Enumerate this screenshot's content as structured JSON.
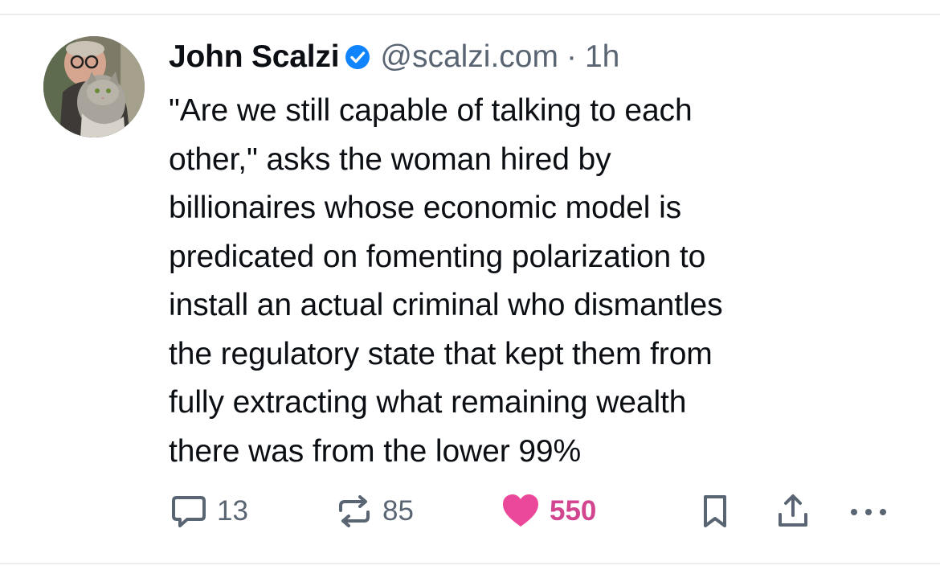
{
  "post": {
    "author": {
      "display_name": "John Scalzi",
      "handle": "@scalzi.com",
      "verified": true,
      "avatar_icon": "avatar-man-with-cat"
    },
    "separator": "·",
    "timestamp": "1h",
    "text": "\"Are we still capable of talking to each\nother,\" asks the woman hired by\nbillionaires whose economic model is\npredicated on fomenting polarization to\ninstall an actual criminal who dismantles\nthe regulatory state that kept them from\nfully extracting what remaining wealth\nthere was from the lower 99%"
  },
  "actions": {
    "reply": {
      "icon": "speech-bubble-icon",
      "count": "13"
    },
    "repost": {
      "icon": "repost-arrows-icon",
      "count": "85"
    },
    "like": {
      "icon": "heart-icon",
      "count": "550",
      "liked": true
    },
    "bookmark": {
      "icon": "bookmark-icon"
    },
    "share": {
      "icon": "share-icon"
    },
    "more": {
      "icon": "more-dots-icon"
    }
  },
  "colors": {
    "verified_blue": "#1083fe",
    "muted_text": "#5a6573",
    "like_pink": "#d2458f",
    "like_heart": "#ec4899"
  }
}
